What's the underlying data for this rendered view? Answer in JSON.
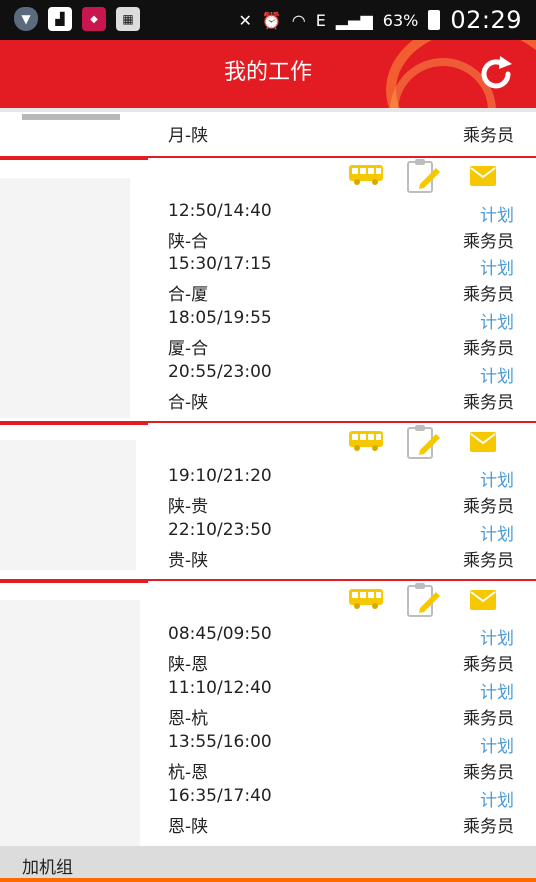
{
  "status": {
    "battery_pct": "63%",
    "time": "02:29",
    "network": "E"
  },
  "header": {
    "title": "我的工作"
  },
  "top_partial": {
    "route": "月-陕",
    "role": "乘务员"
  },
  "groups": [
    {
      "flights": [
        {
          "time": "12:50/14:40",
          "route": "陕-合",
          "status": "计划",
          "role": "乘务员"
        },
        {
          "time": "15:30/17:15",
          "route": "合-厦",
          "status": "计划",
          "role": "乘务员"
        },
        {
          "time": "18:05/19:55",
          "route": "厦-合",
          "status": "计划",
          "role": "乘务员"
        },
        {
          "time": "20:55/23:00",
          "route": "合-陕",
          "status": "计划",
          "role": "乘务员"
        }
      ]
    },
    {
      "flights": [
        {
          "time": "19:10/21:20",
          "route": "陕-贵",
          "status": "计划",
          "role": "乘务员"
        },
        {
          "time": "22:10/23:50",
          "route": "贵-陕",
          "status": "计划",
          "role": "乘务员"
        }
      ]
    },
    {
      "flights": [
        {
          "time": "08:45/09:50",
          "route": "陕-恩",
          "status": "计划",
          "role": "乘务员"
        },
        {
          "time": "11:10/12:40",
          "route": "恩-杭",
          "status": "计划",
          "role": "乘务员"
        },
        {
          "time": "13:55/16:00",
          "route": "杭-恩",
          "status": "计划",
          "role": "乘务员"
        },
        {
          "time": "16:35/17:40",
          "route": "恩-陕",
          "status": "计划",
          "role": "乘务员"
        }
      ]
    }
  ],
  "footer": {
    "label": "加机组"
  },
  "colors": {
    "brand_red": "#e31b23",
    "link_blue": "#4a9ad6",
    "icon_yellow": "#f6c800",
    "footer_accent": "#ff6a00"
  },
  "icons": [
    "bus-icon",
    "clipboard-edit-icon",
    "mail-icon",
    "refresh-icon"
  ]
}
